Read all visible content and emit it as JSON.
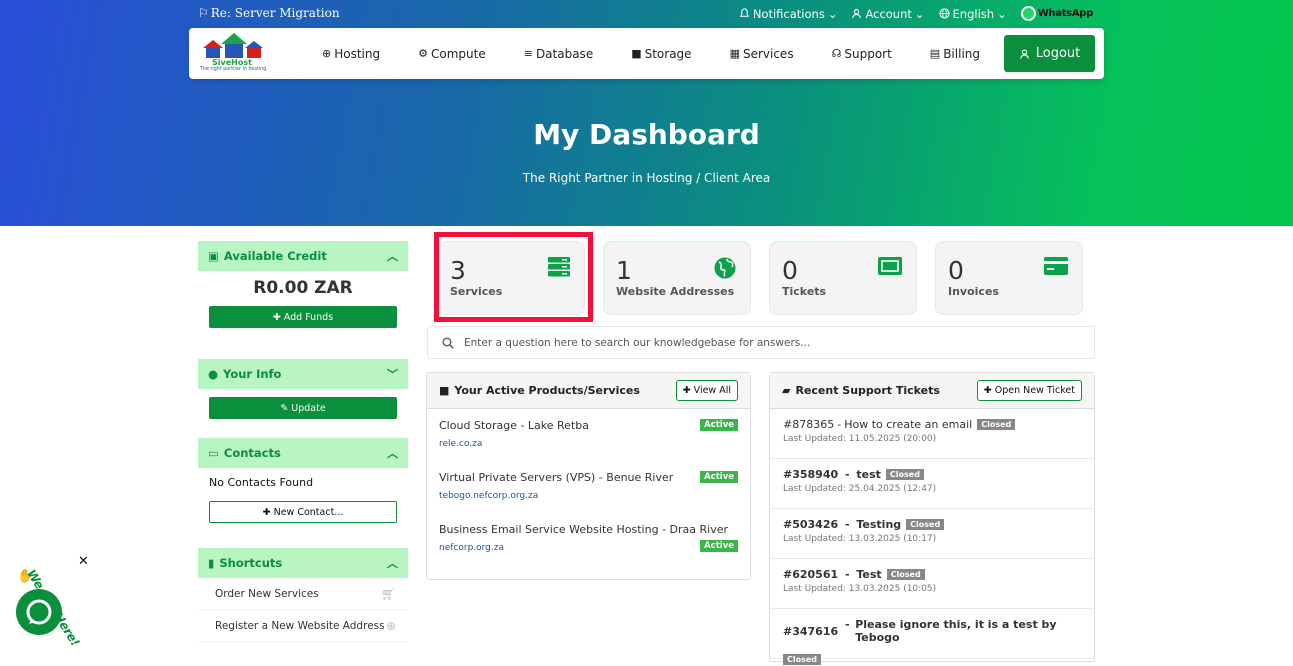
{
  "topbar": {
    "message": "Re: Server Migration",
    "notifications": "Notifications",
    "account": "Account",
    "language": "English",
    "whatsapp": "WhatsApp"
  },
  "brand": {
    "name": "SiveHost",
    "tagline": "The right partner in hosting."
  },
  "nav": {
    "items": [
      {
        "label": "Hosting",
        "icon": "globe-icon"
      },
      {
        "label": "Compute",
        "icon": "gear-icon"
      },
      {
        "label": "Database",
        "icon": "database-icon"
      },
      {
        "label": "Storage",
        "icon": "cube-icon"
      },
      {
        "label": "Services",
        "icon": "gift-icon"
      },
      {
        "label": "Support",
        "icon": "headset-icon"
      },
      {
        "label": "Billing",
        "icon": "invoice-icon"
      }
    ],
    "logout": "Logout"
  },
  "hero": {
    "title": "My Dashboard",
    "crumb1": "The Right Partner in Hosting",
    "crumb2": "/ Client Area"
  },
  "sidebar": {
    "credit": {
      "title": "Available Credit",
      "value": "R0.00 ZAR",
      "button": "Add Funds"
    },
    "info": {
      "title": "Your Info",
      "button": "Update"
    },
    "contacts": {
      "title": "Contacts",
      "empty": "No Contacts Found",
      "button": "New Contact..."
    },
    "shortcuts": {
      "title": "Shortcuts",
      "items": [
        "Order New Services",
        "Register a New Website Address"
      ]
    }
  },
  "stats": [
    {
      "value": "3",
      "label": "Services",
      "icon": "server-icon"
    },
    {
      "value": "1",
      "label": "Website Addresses",
      "icon": "globe-icon"
    },
    {
      "value": "0",
      "label": "Tickets",
      "icon": "ticket-icon"
    },
    {
      "value": "0",
      "label": "Invoices",
      "icon": "credit-card-icon"
    }
  ],
  "search": {
    "placeholder": "Enter a question here to search our knowledgebase for answers..."
  },
  "products": {
    "title": "Your Active Products/Services",
    "button": "View All",
    "items": [
      {
        "name": "Cloud Storage - Lake Retba",
        "domain": "rele.co.za",
        "status": "Active"
      },
      {
        "name": "Virtual Private Servers (VPS) - Benue River",
        "domain": "tebogo.nefcorp.org.za",
        "status": "Active"
      },
      {
        "name": "Business Email Service Website Hosting - Draa River",
        "domain": "nefcorp.org.za",
        "status": "Active"
      }
    ]
  },
  "tickets": {
    "title": "Recent Support Tickets",
    "button": "Open New Ticket",
    "items": [
      {
        "id": "#878365",
        "subject": "How to create an email",
        "status": "Closed",
        "updated": "Last Updated: 11.05.2025 (20:00)"
      },
      {
        "id": "#358940",
        "subject": "test",
        "status": "Closed",
        "updated": "Last Updated: 25.04.2025 (12:47)"
      },
      {
        "id": "#503426",
        "subject": "Testing",
        "status": "Closed",
        "updated": "Last Updated: 13.03.2025 (10:17)"
      },
      {
        "id": "#620561",
        "subject": "Test",
        "status": "Closed",
        "updated": "Last Updated: 13.03.2025 (10:05)"
      },
      {
        "id": "#347616",
        "subject": "Please ignore this, it is a test by Tebogo",
        "status": "Closed",
        "updated": ""
      }
    ]
  },
  "chat": {
    "tag": "We Are Here!"
  },
  "colors": {
    "accent": "#0a8f3c",
    "highlight": "#f0123c",
    "badge_active": "#3bb54a",
    "badge_closed": "#888888"
  }
}
